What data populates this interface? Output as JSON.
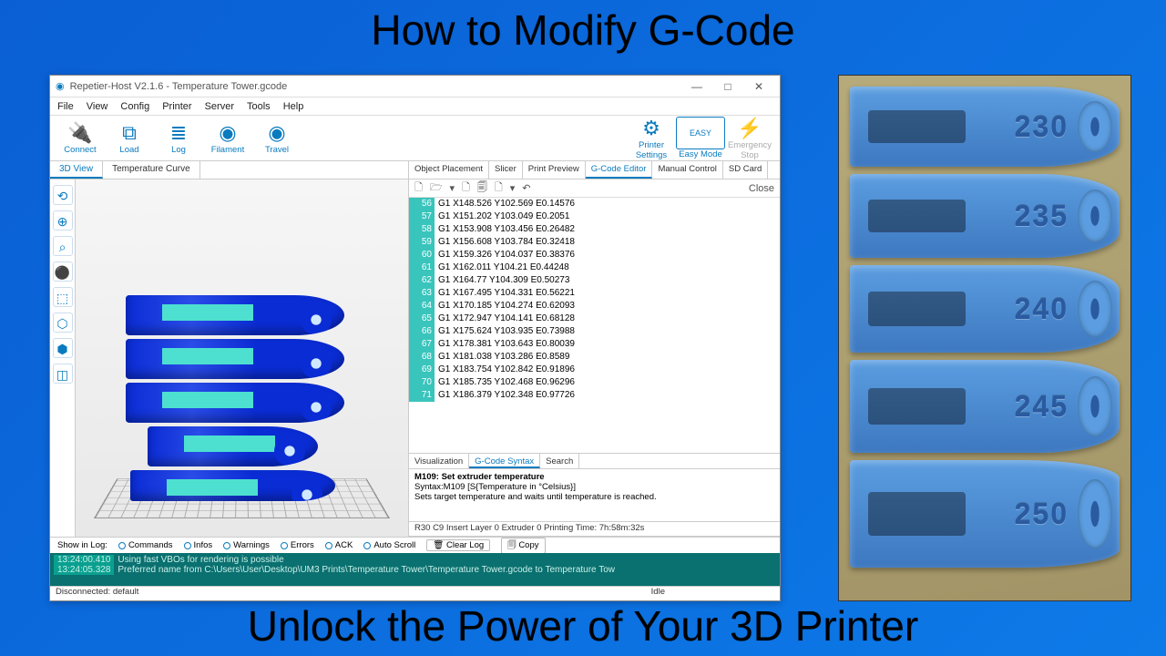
{
  "overlay": {
    "title_top": "How to Modify G-Code",
    "title_bottom": "Unlock the Power of Your 3D Printer"
  },
  "window": {
    "title": "Repetier-Host V2.1.6 - Temperature Tower.gcode",
    "win_min": "—",
    "win_max": "□",
    "win_close": "✕"
  },
  "menu": {
    "items": [
      "File",
      "View",
      "Config",
      "Printer",
      "Server",
      "Tools",
      "Help"
    ]
  },
  "toolbar": {
    "connect": "Connect",
    "load": "Load",
    "log": "Log",
    "filament": "Filament",
    "travel": "Travel",
    "printer_settings": "Printer Settings",
    "easy_mode": "Easy Mode",
    "emergency": "Emergency Stop"
  },
  "left_tabs": [
    "3D View",
    "Temperature Curve"
  ],
  "side_tools": [
    "⟲",
    "⊕",
    "⌕",
    "⚫",
    "⬚",
    "⬡",
    "⬢",
    "◫"
  ],
  "right_tabs": [
    "Object Placement",
    "Slicer",
    "Print Preview",
    "G-Code Editor",
    "Manual Control",
    "SD Card"
  ],
  "editor_tools": [
    "🗋",
    "🗁",
    "▾",
    "🗋",
    "🗐",
    "🗋",
    "▾",
    "↶"
  ],
  "editor_close": "Close",
  "gcode": [
    {
      "n": 56,
      "t": "G1 X148.526 Y102.569 E0.14576"
    },
    {
      "n": 57,
      "t": "G1 X151.202 Y103.049 E0.2051"
    },
    {
      "n": 58,
      "t": "G1 X153.908 Y103.456 E0.26482"
    },
    {
      "n": 59,
      "t": "G1 X156.608 Y103.784 E0.32418"
    },
    {
      "n": 60,
      "t": "G1 X159.326 Y104.037 E0.38376"
    },
    {
      "n": 61,
      "t": "G1 X162.011 Y104.21 E0.44248"
    },
    {
      "n": 62,
      "t": "G1 X164.77 Y104.309 E0.50273"
    },
    {
      "n": 63,
      "t": "G1 X167.495 Y104.331 E0.56221"
    },
    {
      "n": 64,
      "t": "G1 X170.185 Y104.274 E0.62093"
    },
    {
      "n": 65,
      "t": "G1 X172.947 Y104.141 E0.68128"
    },
    {
      "n": 66,
      "t": "G1 X175.624 Y103.935 E0.73988"
    },
    {
      "n": 67,
      "t": "G1 X178.381 Y103.643 E0.80039"
    },
    {
      "n": 68,
      "t": "G1 X181.038 Y103.286 E0.8589"
    },
    {
      "n": 69,
      "t": "G1 X183.754 Y102.842 E0.91896"
    },
    {
      "n": 70,
      "t": "G1 X185.735 Y102.468 E0.96296"
    },
    {
      "n": 71,
      "t": "G1 X186.379 Y102.348 E0.97726"
    }
  ],
  "bottom_tabs": [
    "Visualization",
    "G-Code Syntax",
    "Search"
  ],
  "syntax": {
    "title": "M109: Set extruder temperature",
    "line": "Syntax:M109 [S{Temperature in °Celsius}]",
    "desc": "Sets target temperature and waits until temperature is reached."
  },
  "status_editor": "R30  C9 Insert  Layer 0  Extruder 0  Printing Time: 7h:58m:32s",
  "log_filter": {
    "label": "Show in Log:",
    "items": [
      "Commands",
      "Infos",
      "Warnings",
      "Errors",
      "ACK",
      "Auto Scroll"
    ],
    "clear": "Clear Log",
    "copy": "Copy"
  },
  "log": [
    {
      "ts": "13:24:00.410",
      "msg": "Using fast VBOs for rendering is possible"
    },
    {
      "ts": "13:24:05.328",
      "msg": "Preferred name from C:\\Users\\User\\Desktop\\UM3 Prints\\Temperature Tower\\Temperature Tower.gcode to Temperature Tow"
    }
  ],
  "statusbar": {
    "conn": "Disconnected: default",
    "idle": "Idle"
  },
  "photo_temps": [
    "230",
    "235",
    "240",
    "245",
    "250"
  ]
}
